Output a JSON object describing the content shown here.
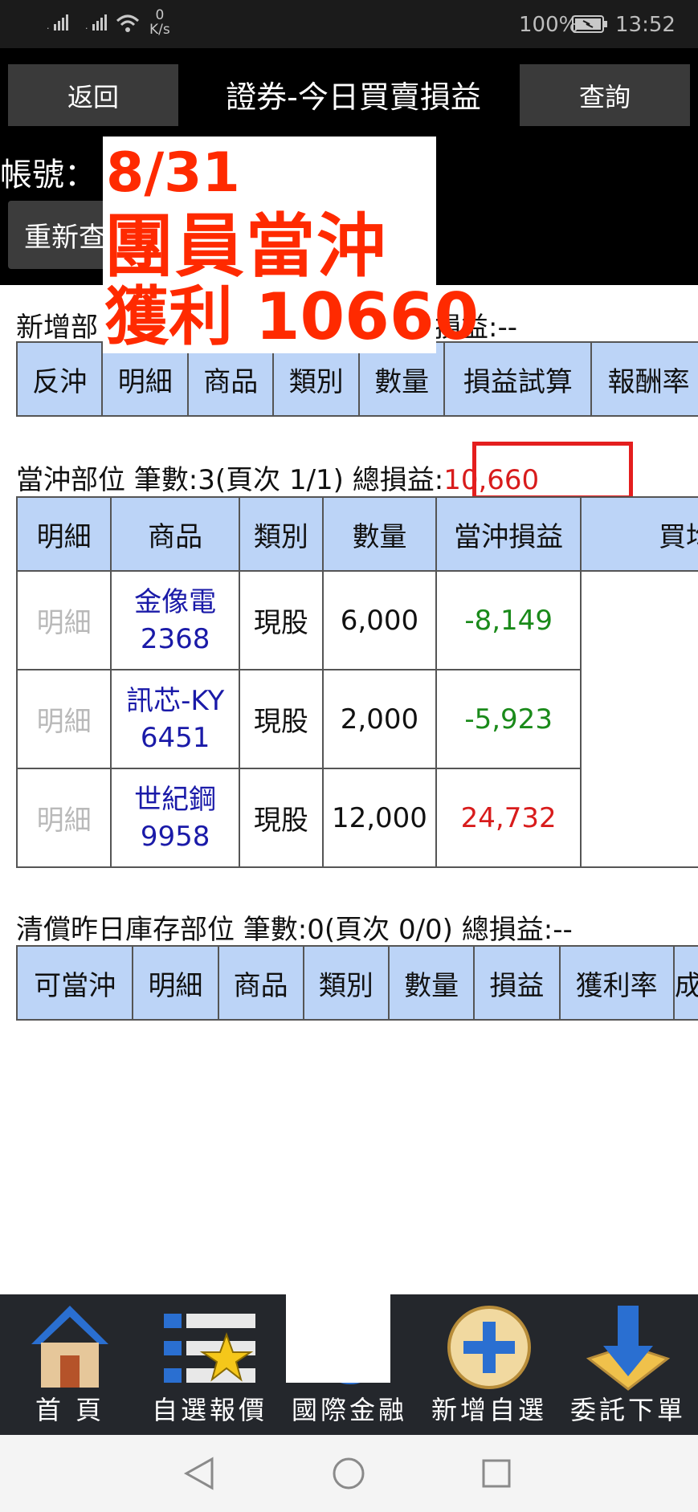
{
  "status_bar": {
    "net_speed_value": "0",
    "net_speed_unit": "K/s",
    "battery": "100%",
    "time": "13:52"
  },
  "header": {
    "back_label": "返回",
    "title": "證券-今日買賣損益",
    "query_label": "查詢",
    "account_label": "帳號：",
    "refresh_label": "重新查"
  },
  "overlay": {
    "date": "8/31",
    "line1": "團員當沖",
    "line2": "獲利 10660"
  },
  "new_positions": {
    "title": "新增部",
    "total_suffix": "損益:--",
    "columns": [
      "反沖",
      "明細",
      "商品",
      "類別",
      "數量",
      "損益試算",
      "報酬率"
    ]
  },
  "daytrade": {
    "title": "當沖部位 筆數:3(頁次 1/1) 總損益:",
    "total": "10,660",
    "columns": [
      "明細",
      "商品",
      "類別",
      "數量",
      "當沖損益",
      "買均"
    ],
    "rows": [
      {
        "detail": "明細",
        "name": "金像電",
        "code": "2368",
        "type": "現股",
        "qty": "6,000",
        "pnl": "-8,149"
      },
      {
        "detail": "明細",
        "name": "訊芯-KY",
        "code": "6451",
        "type": "現股",
        "qty": "2,000",
        "pnl": "-5,923"
      },
      {
        "detail": "明細",
        "name": "世紀鋼",
        "code": "9958",
        "type": "現股",
        "qty": "12,000",
        "pnl": "24,732"
      }
    ]
  },
  "liquidation": {
    "title": "清償昨日庫存部位 筆數:0(頁次 0/0) 總損益:--",
    "columns": [
      "可當沖",
      "明細",
      "商品",
      "類別",
      "數量",
      "損益",
      "獲利率",
      "成"
    ]
  },
  "bottom_nav": {
    "items": [
      {
        "label": "首 頁",
        "icon": "home-icon"
      },
      {
        "label": "自選報價",
        "icon": "watchlist-icon"
      },
      {
        "label": "國際金融",
        "icon": "globe-icon"
      },
      {
        "label": "新增自選",
        "icon": "add-circle-icon"
      },
      {
        "label": "委託下單",
        "icon": "order-arrow-icon"
      }
    ]
  },
  "colors": {
    "header_bg": "#000000",
    "table_header_bg": "#bcd4f7",
    "loss": "#1a8a1a",
    "gain": "#d81c1c",
    "overlay_text": "#ff2a00"
  }
}
